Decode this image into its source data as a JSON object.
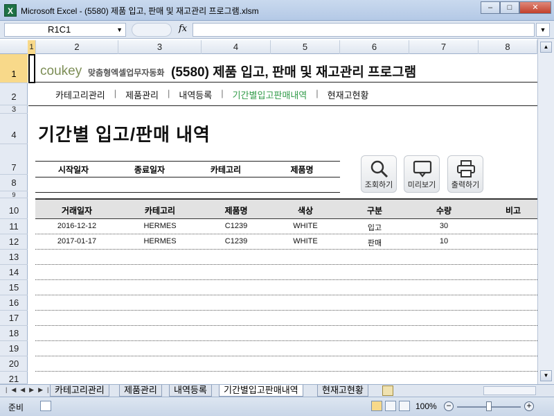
{
  "window": {
    "title": "Microsoft Excel - (5580) 제품 입고, 판매 및 재고관리 프로그램.xlsm",
    "app_icon": "excel-icon",
    "buttons": {
      "minimize": "–",
      "restore": "□",
      "close": "✕"
    }
  },
  "formula_bar": {
    "name_box": "R1C1",
    "fx": "fx",
    "value": ""
  },
  "columns": [
    "1",
    "2",
    "3",
    "4",
    "5",
    "6",
    "7",
    "8"
  ],
  "rows": [
    "1",
    "2",
    "3",
    "4",
    "7",
    "8",
    "9",
    "10",
    "11",
    "12",
    "13",
    "14",
    "15",
    "16",
    "17",
    "18",
    "19",
    "20",
    "21"
  ],
  "header": {
    "logo": "coukey",
    "logo_sub": "맞춤형엑셀업무자동화",
    "title": "(5580) 제품 입고, 판매 및 재고관리 프로그램"
  },
  "menu": {
    "items": [
      {
        "label": "카테고리관리",
        "active": false
      },
      {
        "label": "제품관리",
        "active": false
      },
      {
        "label": "내역등록",
        "active": false
      },
      {
        "label": "기간별입고판매내역",
        "active": true
      },
      {
        "label": "현재고현황",
        "active": false
      }
    ],
    "separator": "|",
    "active_color": "#2f9a47"
  },
  "page_title": "기간별 입고/판매 내역",
  "filter": {
    "headers": [
      "시작일자",
      "종료일자",
      "카테고리",
      "제품명"
    ],
    "values": [
      "",
      "",
      "",
      ""
    ]
  },
  "actions": {
    "search": {
      "label": "조회하기",
      "icon": "magnifier-icon"
    },
    "preview": {
      "label": "미리보기",
      "icon": "monitor-icon"
    },
    "print": {
      "label": "출력하기",
      "icon": "printer-icon"
    }
  },
  "table": {
    "headers": [
      "거래일자",
      "카테고리",
      "제품명",
      "색상",
      "구분",
      "수량",
      "비고"
    ],
    "rows": [
      [
        "2016-12-12",
        "HERMES",
        "C1239",
        "WHITE",
        "입고",
        "30",
        ""
      ],
      [
        "2017-01-17",
        "HERMES",
        "C1239",
        "WHITE",
        "판매",
        "10",
        ""
      ]
    ]
  },
  "sheet_tabs": [
    {
      "label": "카테고리관리",
      "active": false
    },
    {
      "label": "제품관리",
      "active": false
    },
    {
      "label": "내역등록",
      "active": false
    },
    {
      "label": "기간별입고판매내역",
      "active": true
    },
    {
      "label": "현재고현황",
      "active": false
    }
  ],
  "status": {
    "ready": "준비",
    "zoom": "100%"
  }
}
